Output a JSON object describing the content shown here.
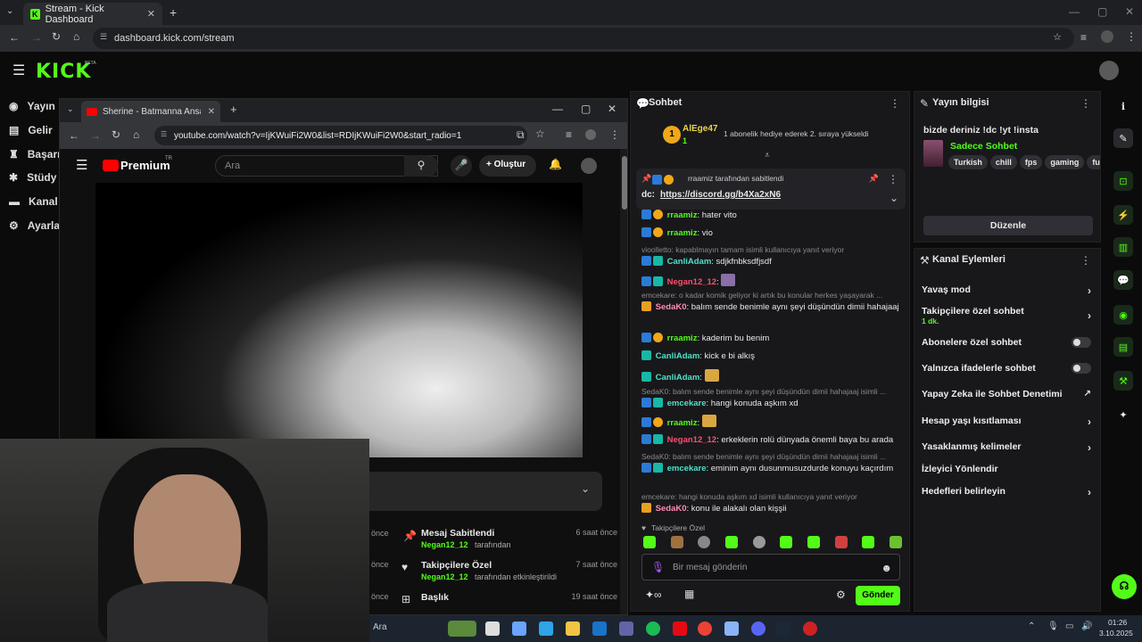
{
  "browser": {
    "tab_title": "Stream - Kick Dashboard",
    "url": "dashboard.kick.com/stream"
  },
  "kick": {
    "logo": "KICK",
    "beta": "BETA",
    "nav": [
      "Yayın",
      "Gelir",
      "Başarı",
      "Stüdy",
      "Kanal",
      "Ayarla"
    ]
  },
  "youtube": {
    "tab_title": "Sherine - Batmanna Ansak | شيرين",
    "url": "youtube.com/watch?v=IjKWuiFi2W0&list=RDIjKWuiFi2W0&start_radio=1",
    "brand": "Premium",
    "brand_sup": "TR",
    "search_placeholder": "Ara",
    "create_label": "Oluştur",
    "activity": [
      {
        "title": "Mesaj Sabitlendi",
        "user": "Negan12_12",
        "suffix": "tarafından",
        "time": "6 saat önce",
        "left": "önce"
      },
      {
        "title": "Takipçilere Özel",
        "user": "Negan12_12",
        "suffix": "tarafından etkinleştirildi",
        "time": "7 saat önce",
        "left": "önce"
      },
      {
        "title": "Başlık",
        "user": "",
        "suffix": "",
        "time": "19 saat önce",
        "left": "önce"
      }
    ]
  },
  "chat": {
    "title": "Sohbet",
    "sub_user": "AlEge47",
    "sub_count": "1",
    "sub_msg": "1 abonelik hediye ederek 2. sıraya yükseldi",
    "pinned_by": "rraamiz tarafından sabitlendi",
    "pinned_user": "rraamiz",
    "pinned_text_prefix": "dc: ",
    "pinned_link": "https://discord.gg/b4Xa2xN6",
    "messages": [
      {
        "user": "rraamiz",
        "text": ": hater vito",
        "color": "green"
      },
      {
        "user": "rraamiz",
        "text": ": vio",
        "color": "green"
      },
      {
        "reply": "vioolletto: kapablmayın tamam isimli kullanıcıya yanıt veriyor",
        "user": "CanliAdam",
        "text": ": sdjkfnbksdfjsdf",
        "color": "cyan"
      },
      {
        "user": "Negan12_12",
        "text": ":",
        "color": "red"
      },
      {
        "reply": "emcekare: o kadar komik geliyor ki artık bu konular herkes yaşayarak ...",
        "user": "SedaK0",
        "text": ": balım sende benimle aynı şeyi düşündün dimii hahajaaj",
        "color": "pink"
      },
      {
        "user": "rraamiz",
        "text": ": kaderim bu benim",
        "color": "green"
      },
      {
        "user": "CanliAdam",
        "text": ": kick e bi alkış",
        "color": "cyan"
      },
      {
        "user": "CanliAdam",
        "text": ":",
        "color": "cyan"
      },
      {
        "reply": "SedaK0: balım sende benimle aynı şeyi düşündün dimii hahajaaj isimli ...",
        "user": "emcekare",
        "text": ": hangi konuda aşkım xd",
        "color": "cyan"
      },
      {
        "user": "rraamiz",
        "text": ":",
        "color": "green"
      },
      {
        "user": "Negan12_12",
        "text": ": erkeklerin rolü dünyada önemli baya bu arada",
        "color": "red"
      },
      {
        "reply": "SedaK0: balım sende benimle aynı şeyi düşündün dimii hahajaaj isimli ...",
        "user": "emcekare",
        "text": ": eminim aynı dusunmusuzdurde konuyu kaçırdım",
        "color": "cyan"
      },
      {
        "reply": "emcekare: hangi konuda aşkım xd isimli kullanıcıya yanıt veriyor",
        "user": "SedaK0",
        "text": ": konu ile alakalı olan kişşii",
        "color": "pink"
      }
    ],
    "followers_only": "Takipçilere Özel",
    "input_placeholder": "Bir mesaj gönderin",
    "send_label": "Gönder"
  },
  "info": {
    "title": "Yayın bilgisi",
    "stream_title": "bizde deriniz !dc !yt !insta",
    "category": "Sadece Sohbet",
    "tags": [
      "Turkish",
      "chill",
      "fps",
      "gaming",
      "fu"
    ],
    "edit_label": "Düzenle"
  },
  "actions": {
    "title": "Kanal Eylemleri",
    "items": [
      {
        "label": "Yavaş mod",
        "kind": "chevron"
      },
      {
        "label": "Takipçilere özel sohbet",
        "sub": "1 dk.",
        "kind": "chevron"
      },
      {
        "label": "Abonelere özel sohbet",
        "kind": "toggle"
      },
      {
        "label": "Yalnızca ifadelerle sohbet",
        "kind": "toggle"
      },
      {
        "label": "Yapay Zeka ile Sohbet Denetimi",
        "kind": "external"
      },
      {
        "label": "Hesap yaşı kısıtlaması",
        "kind": "chevron"
      },
      {
        "label": "Yasaklanmış kelimeler",
        "kind": "chevron"
      },
      {
        "label": "İzleyici Yönlendir",
        "kind": "none"
      },
      {
        "label": "Hedefleri belirleyin",
        "kind": "chevron"
      }
    ]
  },
  "taskbar": {
    "search": "Ara",
    "time": "01:26",
    "date": "3.10.2025"
  },
  "colors": {
    "kick_green": "#53fc18",
    "panel": "#18181b",
    "background": "#0b0b0c"
  }
}
